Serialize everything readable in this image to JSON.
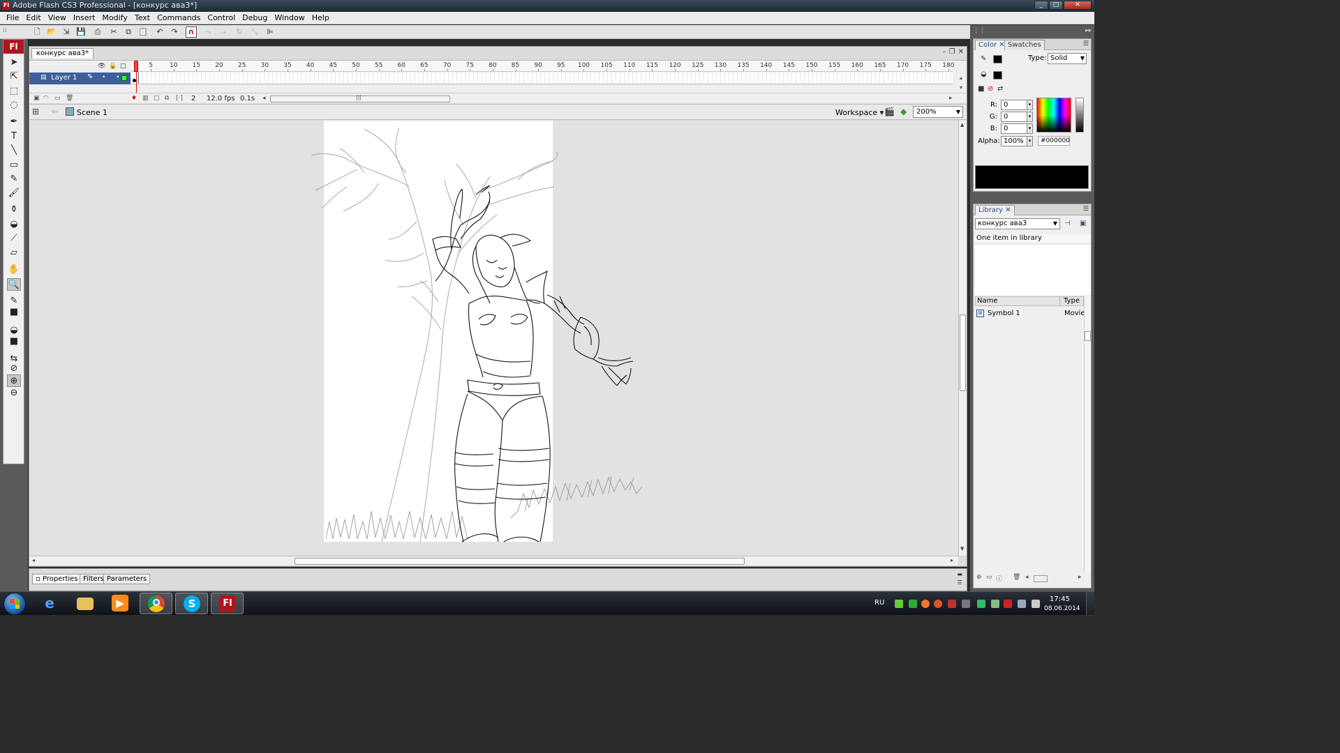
{
  "window": {
    "app_icon": "Fl",
    "title": "Adobe Flash CS3 Professional - [конкурс ава3*]",
    "buttons": [
      "_",
      "□",
      "✕"
    ]
  },
  "menu": [
    "File",
    "Edit",
    "View",
    "Insert",
    "Modify",
    "Text",
    "Commands",
    "Control",
    "Debug",
    "Window",
    "Help"
  ],
  "main_toolbar": {
    "icons": [
      "new-icon",
      "open-icon",
      "bridge-icon",
      "save-icon",
      "print-icon",
      "cut-icon",
      "copy-icon",
      "paste-icon",
      "undo-icon",
      "redo-icon",
      "snap-magnet-icon",
      "smooth-icon",
      "straighten-icon",
      "rotate-icon",
      "scale-icon",
      "align-icon"
    ],
    "active": "snap-magnet-icon"
  },
  "tools": {
    "logo": "Fl",
    "items": [
      "selection-tool-icon",
      "subselection-tool-icon",
      "free-transform-tool-icon",
      "lasso-tool-icon",
      "pen-tool-icon",
      "text-tool-icon",
      "line-tool-icon",
      "rectangle-tool-icon",
      "pencil-tool-icon",
      "brush-tool-icon",
      "ink-bottle-tool-icon",
      "paint-bucket-tool-icon",
      "eyedropper-tool-icon",
      "eraser-tool-icon",
      "hand-tool-icon",
      "zoom-tool-icon",
      "stroke-color-icon",
      "stroke-swatch-icon",
      "fill-color-icon",
      "fill-swatch-icon",
      "swap-colors-icon",
      "no-color-icon",
      "zoom-in-option-icon",
      "zoom-out-option-icon"
    ],
    "selected": "zoom-tool-icon"
  },
  "document": {
    "tab": "конкурс ава3*",
    "controls": [
      "–",
      "❐",
      "✕"
    ]
  },
  "timeline": {
    "header_icons": [
      "eye-icon",
      "lock-icon",
      "outline-icon"
    ],
    "ruler": [
      "5",
      "10",
      "15",
      "20",
      "25",
      "30",
      "35",
      "40",
      "45",
      "50",
      "55",
      "60",
      "65",
      "70",
      "75",
      "80",
      "85",
      "90",
      "95",
      "100",
      "105",
      "110",
      "115",
      "120",
      "125",
      "130",
      "135",
      "140",
      "145",
      "150",
      "155",
      "160",
      "165",
      "170",
      "175",
      "180"
    ],
    "layer": {
      "name": "Layer 1",
      "dots": "• •"
    },
    "current_frame": "2",
    "fps": "12.0 fps",
    "elapsed": "0.1s",
    "scroll_mark": "|||"
  },
  "editbar": {
    "scene": "Scene 1",
    "workspace": "Workspace ▾",
    "zoom": "200%"
  },
  "properties_panel": {
    "tabs": [
      "Properties",
      "Filters",
      "Parameters"
    ],
    "active_tab": "Properties",
    "tab_prefix": "▫",
    "close": "✕"
  },
  "color_panel": {
    "tabs": [
      "Color",
      "Swatches"
    ],
    "active_tab": "Color",
    "close": "✕",
    "type_label": "Type:",
    "type_value": "Solid",
    "rgb": [
      {
        "label": "R:",
        "value": "0"
      },
      {
        "label": "G:",
        "value": "0"
      },
      {
        "label": "B:",
        "value": "0"
      },
      {
        "label": "Alpha:",
        "value": "100%"
      }
    ],
    "hex": "#000000",
    "current_color": "#000000"
  },
  "library_panel": {
    "tab": "Library",
    "close": "✕",
    "document": "конкурс ава3",
    "count_text": "One item in library",
    "columns": [
      "Name",
      "Type"
    ],
    "items": [
      {
        "name": "Symbol 1",
        "type": "Movie"
      }
    ]
  },
  "taskbar": {
    "apps": [
      "internet-explorer-icon",
      "windows-explorer-icon",
      "media-player-icon",
      "chrome-icon",
      "skype-icon",
      "flash-icon"
    ],
    "active_app": "flash-icon",
    "lang": "RU",
    "time": "17:45",
    "date": "08.06.2014"
  },
  "colors": {
    "flash_red": "#b0141c",
    "layer_selected": "#3d5f9a",
    "stage": "#ffffff",
    "pasteboard": "#e2e2e2"
  }
}
